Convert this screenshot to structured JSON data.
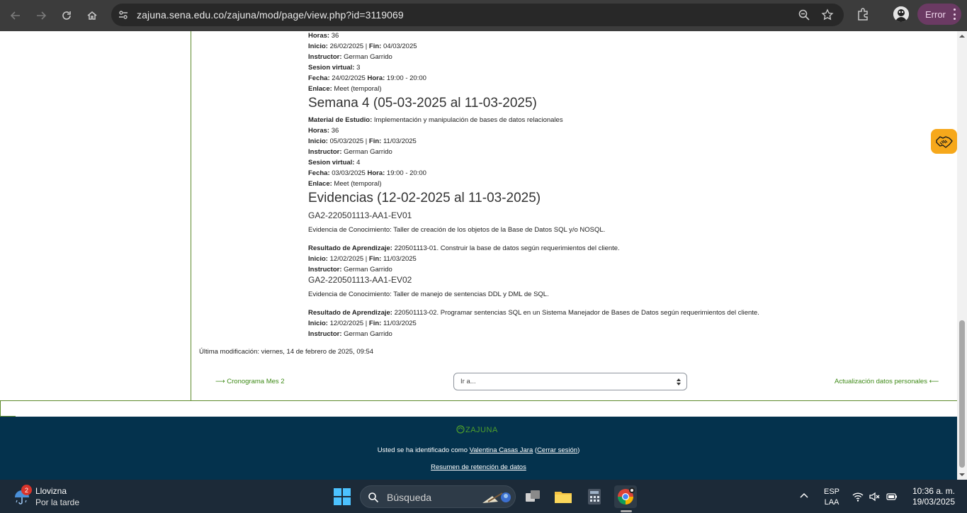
{
  "browser": {
    "url": "zajuna.sena.edu.co/zajuna/mod/page/view.php?id=3119069",
    "profile_status": "Error"
  },
  "content": {
    "semana3_tail": [
      {
        "label": "Horas:",
        "value": " 36"
      },
      {
        "label": "Inicio:",
        "value": " 26/02/2025 | ",
        "label2": "Fin:",
        "value2": " 04/03/2025"
      },
      {
        "label": "Instructor:",
        "value": " German Garrido"
      },
      {
        "label": "Sesion virtual:",
        "value": " 3"
      },
      {
        "label": "Fecha:",
        "value": " 24/02/2025 ",
        "label2": "Hora:",
        "value2": " 19:00 - 20:00"
      },
      {
        "label": "Enlace:",
        "value": " Meet (temporal)"
      }
    ],
    "semana4": {
      "title": "Semana 4 (05-03-2025 al 11-03-2025)",
      "lines": [
        {
          "label": "Material de Estudio:",
          "value": " Implementación y manipulación de bases de datos relacionales"
        },
        {
          "label": "Horas:",
          "value": " 36"
        },
        {
          "label": "Inicio:",
          "value": " 05/03/2025 | ",
          "label2": "Fin:",
          "value2": " 11/03/2025"
        },
        {
          "label": "Instructor:",
          "value": " German Garrido"
        },
        {
          "label": "Sesion virtual:",
          "value": " 4"
        },
        {
          "label": "Fecha:",
          "value": " 03/03/2025 ",
          "label2": "Hora:",
          "value2": " 19:00 - 20:00"
        },
        {
          "label": "Enlace:",
          "value": " Meet (temporal)"
        }
      ]
    },
    "evidencias": {
      "title": "Evidencias (12-02-2025 al 11-03-2025)",
      "items": [
        {
          "code": "GA2-220501113-AA1-EV01",
          "description": "Evidencia de Conocimiento: Taller de creación de los objetos de la Base de Datos SQL y/o NOSQL.",
          "resultado_label": "Resultado de Aprendizaje:",
          "resultado": " 220501113-01. Construir la base de datos según requerimientos del cliente.",
          "inicio_label": "Inicio:",
          "inicio": " 12/02/2025 | ",
          "fin_label": "Fin:",
          "fin": " 11/03/2025",
          "instructor_label": "Instructor:",
          "instructor": " German Garrido"
        },
        {
          "code": "GA2-220501113-AA1-EV02",
          "description": "Evidencia de Conocimiento: Taller de manejo de sentencias DDL y DML de SQL.",
          "resultado_label": "Resultado de Aprendizaje:",
          "resultado": " 220501113-02. Programar sentencias SQL en un Sistema Manejador de Bases de Datos según requerimientos del cliente.",
          "inicio_label": "Inicio:",
          "inicio": " 12/02/2025 | ",
          "fin_label": "Fin:",
          "fin": " 11/03/2025",
          "instructor_label": "Instructor:",
          "instructor": " German Garrido"
        }
      ]
    },
    "last_modified": "Última modificación: viernes, 14 de febrero de 2025, 09:54"
  },
  "navigation": {
    "prev": "⟶ Cronograma Mes 2",
    "jump_placeholder": "Ir a...",
    "next": "Actualización datos personales ⟵"
  },
  "footer": {
    "logo_text": "ZAJUNA",
    "identified_prefix": "Usted se ha identificado como ",
    "user_name": "Valentina Casas Jara",
    "logout_open": " (",
    "logout": "Cerrar sesión",
    "logout_close": ")",
    "retention": "Resumen de retención de datos"
  },
  "taskbar": {
    "weather_badge": "2",
    "weather_title": "Llovizna",
    "weather_subtitle": "Por la tarde",
    "search_placeholder": "Búsqueda",
    "lang_top": "ESP",
    "lang_bottom": "LAA",
    "time": "10:36 a. m.",
    "date": "19/03/2025"
  },
  "colors": {
    "accent_green": "#3e8a17",
    "frame_green": "#5d8a2c",
    "footer_bg": "#04324d",
    "help_orange": "#f6a81b",
    "chrome_bg": "#3c3c3c",
    "error_pill": "#6b3a63"
  }
}
